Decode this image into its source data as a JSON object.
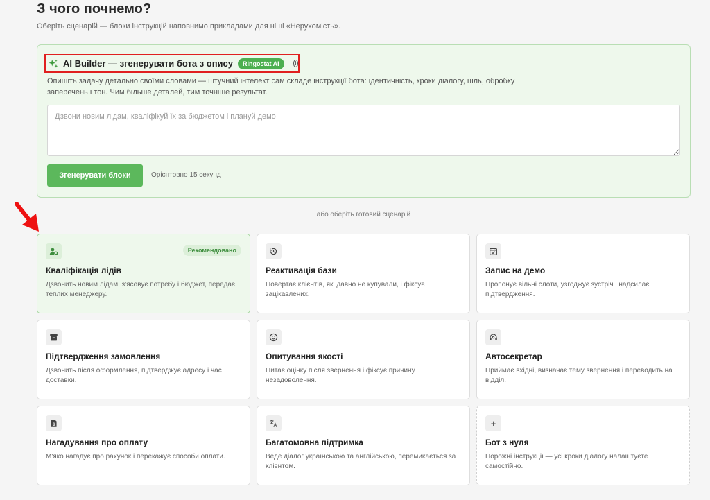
{
  "header": {
    "title": "З чого почнемо?",
    "subtitle": "Оберіть сценарій — блоки інструкцій наповнимо прикладами для ніші «Нерухомість»."
  },
  "ai_builder": {
    "icon": "sparkle-icon",
    "title": "AI Builder — згенерувати бота з опису",
    "badge": "Ringostat AI",
    "info_icon": "info-icon",
    "info_glyph": "i",
    "description": "Опишіть задачу детально своїми словами — штучний інтелект сам складе інструкції бота: ідентичність, кроки діалогу, ціль, обробку заперечень і тон. Чим більше деталей, тим точніше результат.",
    "textarea_value": "",
    "textarea_placeholder": "Дзвони новим лідам, кваліфікуй їх за бюджетом і плануй демо",
    "button_label": "Згенерувати блоки",
    "hint": "Орієнтовно 15 секунд"
  },
  "divider_text": "або оберіть готовий сценарій",
  "scenarios": [
    {
      "title": "Кваліфікація лідів",
      "description": "Дзвонить новим лідам, з'ясовує потребу і бюджет, передає теплих менеджеру.",
      "icon": "person-search-icon",
      "badge": "Рекомендовано",
      "selected": true
    },
    {
      "title": "Реактивація бази",
      "description": "Повертає клієнтів, які давно не купували, і фіксує зацікавлених.",
      "icon": "history-icon"
    },
    {
      "title": "Запис на демо",
      "description": "Пропонує вільні слоти, узгоджує зустріч і надсилає підтвердження.",
      "icon": "calendar-check-icon"
    },
    {
      "title": "Підтвердження замовлення",
      "description": "Дзвонить після оформлення, підтверджує адресу і час доставки.",
      "icon": "archive-box-icon"
    },
    {
      "title": "Опитування якості",
      "description": "Питає оцінку після звернення і фіксує причину незадоволення.",
      "icon": "smiley-icon"
    },
    {
      "title": "Автосекретар",
      "description": "Приймає вхідні, визначає тему звернення і переводить на відділ.",
      "icon": "headset-icon"
    },
    {
      "title": "Нагадування про оплату",
      "description": "М'яко нагадує про рахунок і перекажує способи оплати.",
      "icon": "invoice-icon"
    },
    {
      "title": "Багатомовна підтримка",
      "description": "Веде діалог українською та англійською, перемикається за клієнтом.",
      "icon": "translate-icon"
    },
    {
      "title": "Бот з нуля",
      "description": "Порожні інструкції — усі кроки діалогу налаштуєте самостійно.",
      "icon": "plus-icon",
      "icon_glyph": "+",
      "dashed": true
    }
  ],
  "colors": {
    "accent": "#5cb85c",
    "panel_bg": "#eef8ec",
    "highlight_box": "#e02020",
    "annotation_arrow": "#ee1111"
  }
}
